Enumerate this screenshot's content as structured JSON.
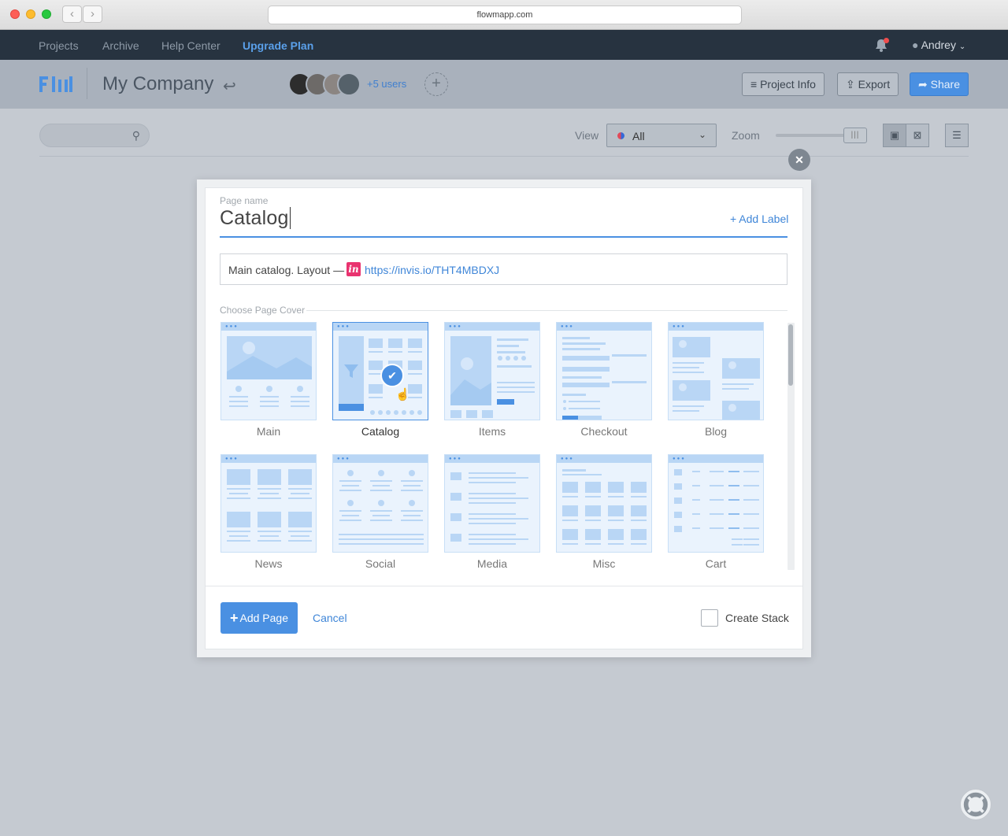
{
  "browser": {
    "url": "flowmapp.com",
    "back": "‹",
    "forward": "›"
  },
  "topnav": {
    "items": [
      "Projects",
      "Archive",
      "Help Center"
    ],
    "upgrade": "Upgrade Plan",
    "user": "Andrey"
  },
  "header": {
    "company": "My Company",
    "users_more": "+5 users",
    "project_info": "Project Info",
    "export": "Export",
    "share": "Share"
  },
  "toolbar": {
    "view_label": "View",
    "view_value": "All",
    "zoom_label": "Zoom"
  },
  "modal": {
    "page_name_label": "Page name",
    "page_name_value": "Catalog",
    "add_label": "+ Add Label",
    "description_text": "Main catalog. Layout —",
    "invision_badge": "in",
    "description_link": "https://invis.io/THT4MBDXJ",
    "cover_label": "Choose Page Cover",
    "covers": [
      "Main",
      "Catalog",
      "Items",
      "Checkout",
      "Blog",
      "News",
      "Social",
      "Media",
      "Misc",
      "Cart"
    ],
    "selected_cover": "Catalog",
    "add_page": "Add Page",
    "cancel": "Cancel",
    "create_stack": "Create Stack"
  },
  "colors": {
    "accent": "#4a90e2",
    "topnav": "#273340",
    "header": "#a9b1bc",
    "overlay": "#c5cad1"
  }
}
